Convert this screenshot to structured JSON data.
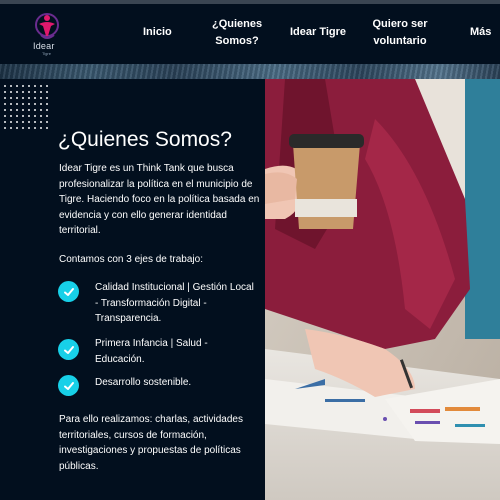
{
  "brand": {
    "logo_text": "Idear",
    "logo_sub": "Tigre"
  },
  "nav": {
    "inicio": "Inicio",
    "quienes_1": "¿Quienes",
    "quienes_2": "Somos?",
    "idear": "Idear Tigre",
    "voluntario_1": "Quiero ser",
    "voluntario_2": "voluntario",
    "mas": "Más"
  },
  "main": {
    "title": "¿Quienes Somos?",
    "description": "Idear Tigre es un Think Tank que busca profesionalizar la política en el municipio de Tigre. Haciendo foco en la política basada en evidencia y con ello generar identidad territorial.",
    "axes_intro": "Contamos con 3 ejes de trabajo:",
    "axes": [
      "Calidad Institucional | Gestión Local - Transformación Digital - Transparencia.",
      "Primera Infancia | Salud - Educación.",
      "Desarrollo sostenible."
    ],
    "closing": "Para ello realizamos: charlas, actividades territoriales, cursos de formación, investigaciones y propuestas de políticas públicas."
  },
  "colors": {
    "background": "#020f1e",
    "accent_check": "#17d0e8",
    "logo_pink": "#e0196d",
    "logo_purple": "#6a2c8f",
    "sweater": "#8b1d3c"
  },
  "icons": {
    "check": "check-icon",
    "logo": "idear-logo-icon"
  }
}
